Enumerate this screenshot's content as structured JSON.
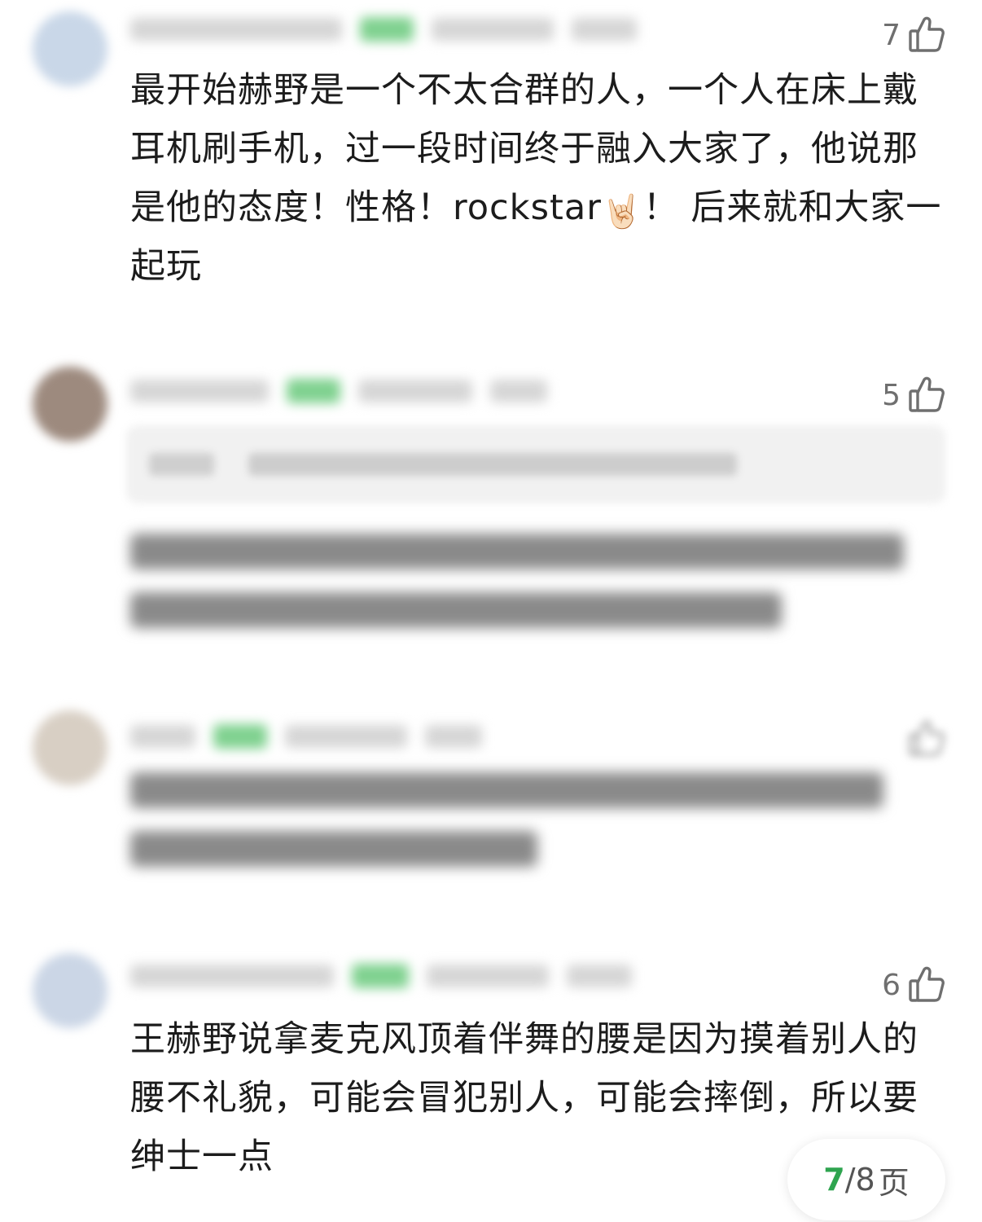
{
  "comments": [
    {
      "likes": "7",
      "text": "最开始赫野是一个不太合群的人，一个人在床上戴耳机刷手机，过一段时间终于融入大家了，他说那是他的态度！性格！rockstar",
      "emoji": "🤘🏻",
      "text_after": "！ 后来就和大家一起玩"
    },
    {
      "likes": "5"
    },
    {
      "likes": ""
    },
    {
      "likes": "6",
      "text": "王赫野说拿麦克风顶着伴舞的腰是因为摸着别人的腰不礼貌，可能会冒犯别人，可能会摔倒，所以要绅士一点"
    }
  ],
  "pager": {
    "current": "7",
    "separator": "/",
    "total": "8",
    "unit": "页"
  },
  "colors": {
    "accent_green": "#2ea44f",
    "like_gray": "#6f6f6f"
  },
  "icons": {
    "like": "thumbs-up-icon"
  }
}
